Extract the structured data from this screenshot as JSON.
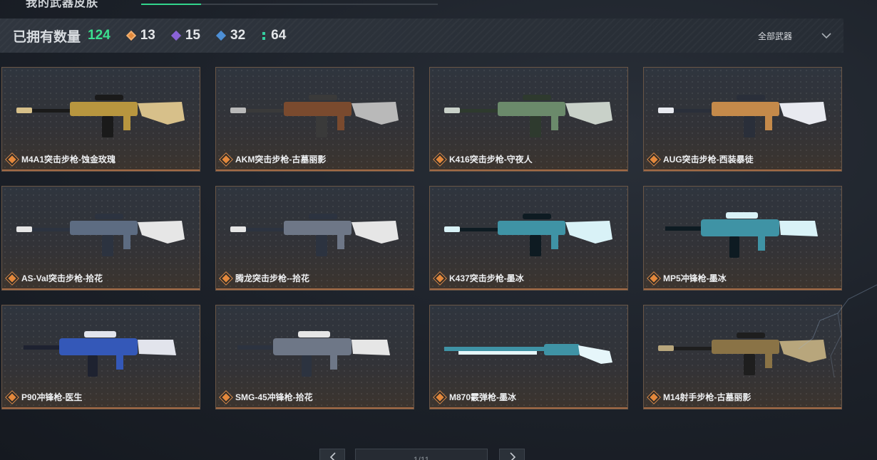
{
  "header": {
    "title": "我的武器皮肤"
  },
  "stats": {
    "owned_label": "已拥有数量",
    "owned_count": "124",
    "tiers": [
      {
        "icon": "orange-diamond-icon",
        "count": "13",
        "color": "#e38a3c"
      },
      {
        "icon": "purple-diamond-icon",
        "count": "15",
        "color": "#8a63d8"
      },
      {
        "icon": "blue-diamond-icon",
        "count": "32",
        "color": "#4d8fd6"
      },
      {
        "icon": "green-bars-icon",
        "count": "64",
        "color": "#35d0a0"
      }
    ],
    "filter_label": "全部武器"
  },
  "skins": [
    {
      "name": "M4A1突击步枪-蚀金玫瑰",
      "icon": "rifle-icon",
      "palette": [
        "#1a1a1a",
        "#b8963f",
        "#d7c08a"
      ]
    },
    {
      "name": "AKM突击步枪-古墓丽影",
      "icon": "rifle-icon",
      "palette": [
        "#3a3a3a",
        "#7a4a2e",
        "#b9b9b9"
      ]
    },
    {
      "name": "K416突击步枪-守夜人",
      "icon": "rifle-icon",
      "palette": [
        "#2e3a2e",
        "#6b8a6b",
        "#c9d1c9"
      ]
    },
    {
      "name": "AUG突击步枪-西装暴徒",
      "icon": "rifle-icon",
      "palette": [
        "#2a2f3a",
        "#c58a4a",
        "#e8eaf0"
      ]
    },
    {
      "name": "AS-Val突击步枪-拾花",
      "icon": "rifle-icon",
      "palette": [
        "#2c3340",
        "#5d6c82",
        "#e6e6e6"
      ]
    },
    {
      "name": "腾龙突击步枪--拾花",
      "icon": "rifle-icon",
      "palette": [
        "#2c3340",
        "#6e7787",
        "#e6e6e6"
      ]
    },
    {
      "name": "K437突击步枪-墨冰",
      "icon": "rifle-icon",
      "palette": [
        "#0e1b22",
        "#3f93a5",
        "#d9f2f7"
      ]
    },
    {
      "name": "MP5冲锋枪-墨冰",
      "icon": "smg-icon",
      "palette": [
        "#0e1b22",
        "#3f93a5",
        "#d9f2f7"
      ]
    },
    {
      "name": "P90冲锋枪-医生",
      "icon": "smg-icon",
      "palette": [
        "#1e2230",
        "#3458b8",
        "#e2e4ec"
      ]
    },
    {
      "name": "SMG-45冲锋枪-拾花",
      "icon": "smg-icon",
      "palette": [
        "#2c3340",
        "#6e7787",
        "#e6e6e6"
      ]
    },
    {
      "name": "M870霰弹枪-墨冰",
      "icon": "shotgun-icon",
      "palette": [
        "#0e1b22",
        "#3f93a5",
        "#e6f6fa"
      ]
    },
    {
      "name": "M14射手步枪-古墓丽影",
      "icon": "rifle-icon",
      "palette": [
        "#1e1e1e",
        "#8a7346",
        "#b8a67c"
      ]
    }
  ],
  "pagination": {
    "page_text": "1/11"
  }
}
